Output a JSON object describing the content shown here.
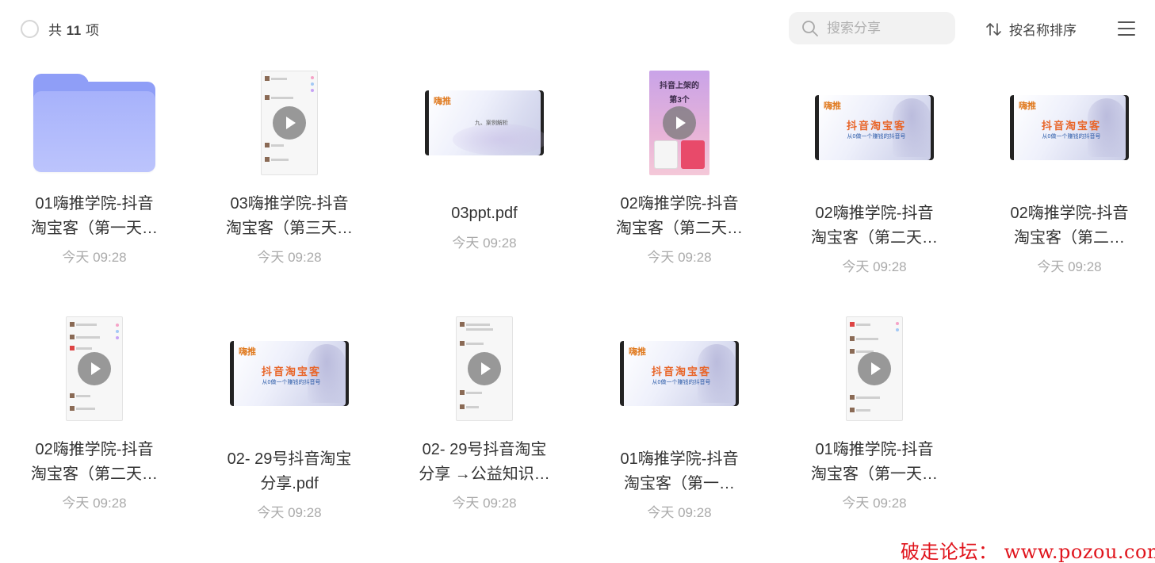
{
  "header": {
    "count_prefix": "共",
    "count_value": "11",
    "count_suffix": "项",
    "search_placeholder": "搜索分享",
    "sort_label": "按名称排序",
    "icons": {
      "select_all": "circle-checkbox-icon",
      "search": "search-icon",
      "sort": "sort-arrows-icon",
      "menu": "hamburger-menu-icon"
    }
  },
  "items": [
    {
      "name_line1": "01嗨推学院-抖音",
      "name_line2": "淘宝客（第一天…",
      "date": "今天 09:28",
      "thumb": "folder"
    },
    {
      "name_line1": "03嗨推学院-抖音",
      "name_line2": "淘宝客（第三天…",
      "date": "今天 09:28",
      "thumb": "video-chat"
    },
    {
      "name_line1": "03ppt.pdf",
      "name_line2": "",
      "date": "今天 09:28",
      "thumb": "pdf-slide"
    },
    {
      "name_line1": "02嗨推学院-抖音",
      "name_line2": "淘宝客（第二天…",
      "date": "今天 09:28",
      "thumb": "video-cover"
    },
    {
      "name_line1": "02嗨推学院-抖音",
      "name_line2": "淘宝客（第二天…",
      "date": "今天 09:28",
      "thumb": "slide"
    },
    {
      "name_line1": "02嗨推学院-抖音",
      "name_line2": "淘宝客（第二…",
      "date": "今天 09:28",
      "thumb": "slide"
    },
    {
      "name_line1": "02嗨推学院-抖音",
      "name_line2": "淘宝客（第二天…",
      "date": "今天 09:28",
      "thumb": "video-chat"
    },
    {
      "name_line1": "02- 29号抖音淘宝",
      "name_line2": "分享.pdf",
      "date": "今天 09:28",
      "thumb": "slide"
    },
    {
      "name_line1": "02- 29号抖音淘宝",
      "name_line2": "分享 →公益知识…",
      "date": "今天 09:28",
      "thumb": "video-chat"
    },
    {
      "name_line1": "01嗨推学院-抖音",
      "name_line2": "淘宝客（第一…",
      "date": "今天 09:28",
      "thumb": "slide"
    },
    {
      "name_line1": "01嗨推学院-抖音",
      "name_line2": "淘宝客（第一天…",
      "date": "今天 09:28",
      "thumb": "video-chat"
    }
  ],
  "slide_text": {
    "logo_a": "嗨推",
    "logo_b": "●",
    "headline": "抖音淘宝客",
    "sub": "从0做一个赚钱的抖音号",
    "pdf_line": "九、案例解析"
  },
  "cover_text": {
    "line1": "抖音上架的",
    "line2": "第3个"
  },
  "watermark": "破走论坛： www.pozou.com",
  "colors": {
    "folder": "#a7b2fb",
    "watermark": "#e0141c",
    "date": "#aaaaaa"
  }
}
